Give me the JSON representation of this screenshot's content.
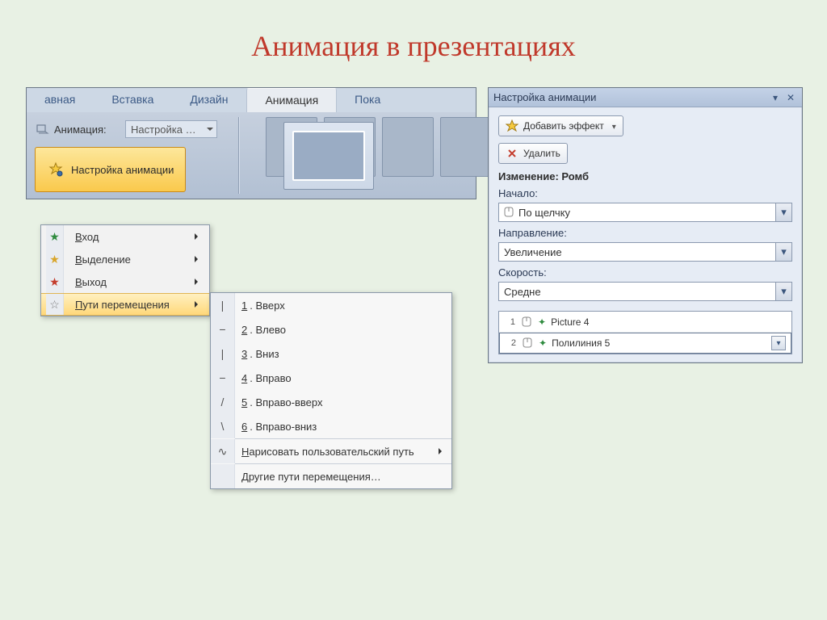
{
  "slide_title": "Анимация в презентациях",
  "ribbon": {
    "tabs": [
      "авная",
      "Вставка",
      "Дизайн",
      "Анимация",
      "Пока"
    ],
    "active_index": 3,
    "anim_label": "Анимация:",
    "anim_dropdown_value": "Настройка …",
    "custom_anim_button": "Настройка анимации"
  },
  "context_menu": {
    "items": [
      {
        "label": "Вход",
        "star": "green"
      },
      {
        "label": "Выделение",
        "star": "yellow"
      },
      {
        "label": "Выход",
        "star": "red"
      },
      {
        "label": "Пути перемещения",
        "star": "outline"
      }
    ],
    "hover_index": 3
  },
  "submenu": {
    "items": [
      {
        "num": "1",
        "label": "Вверх",
        "icon": "|"
      },
      {
        "num": "2",
        "label": "Влево",
        "icon": "−"
      },
      {
        "num": "3",
        "label": "Вниз",
        "icon": "|"
      },
      {
        "num": "4",
        "label": "Вправо",
        "icon": "−"
      },
      {
        "num": "5",
        "label": "Вправо-вверх",
        "icon": "/"
      },
      {
        "num": "6",
        "label": "Вправо-вниз",
        "icon": "\\"
      }
    ],
    "custom_path": "Нарисовать пользовательский путь",
    "more_paths": "Другие пути перемещения…",
    "custom_path_icon": "∿"
  },
  "taskpane": {
    "title": "Настройка анимации",
    "btn_add_effect": "Добавить эффект",
    "btn_remove": "Удалить",
    "section_change": "Изменение: Ромб",
    "label_start": "Начало:",
    "select_start": "По щелчку",
    "label_direction": "Направление:",
    "select_direction": "Увеличение",
    "label_speed": "Скорость:",
    "select_speed": "Средне",
    "list": [
      {
        "order": "1",
        "name": "Picture 4"
      },
      {
        "order": "2",
        "name": "Полилиния 5"
      }
    ],
    "selected_index": 1
  }
}
